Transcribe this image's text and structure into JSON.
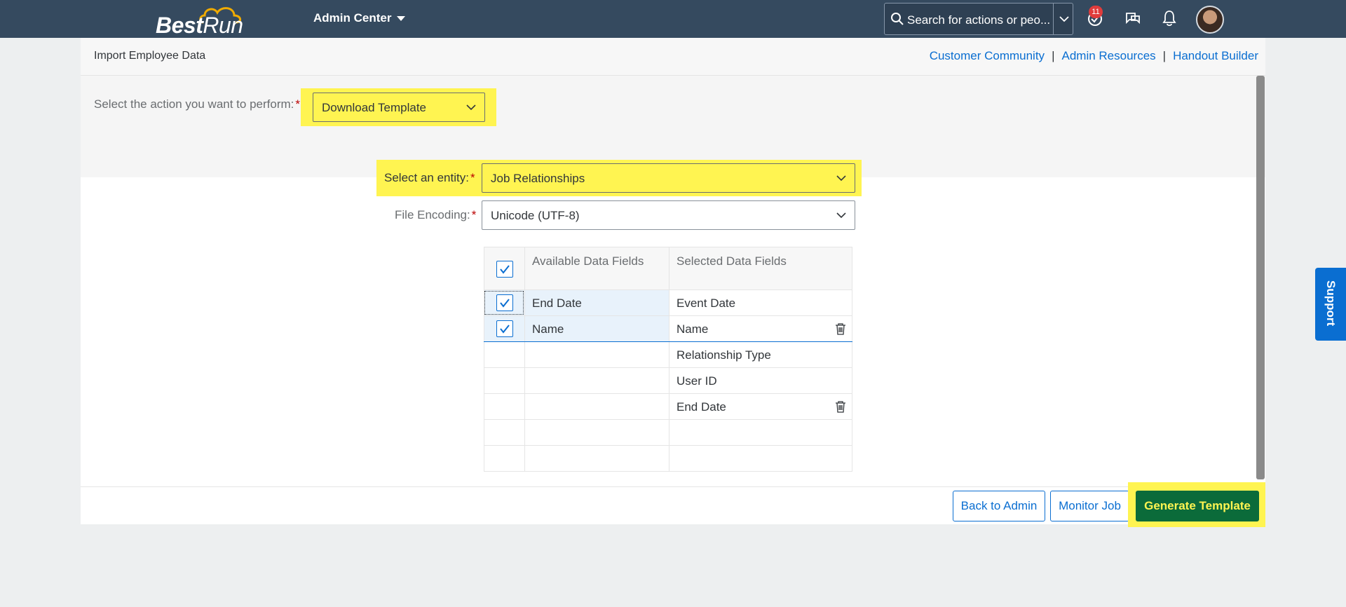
{
  "shell": {
    "logo_main": "Best",
    "logo_run": "Run",
    "menu_title": "Admin Center",
    "search_placeholder": "Search for actions or peo...",
    "notification_count": "11"
  },
  "header": {
    "title": "Import Employee Data",
    "links": [
      "Customer Community",
      "Admin Resources",
      "Handout Builder"
    ],
    "separator": "|"
  },
  "form": {
    "action_label": "Select the action you want to perform:",
    "action_value": "Download Template",
    "entity_label": "Select an entity:",
    "entity_value": "Job Relationships",
    "encoding_label": "File Encoding:",
    "encoding_value": "Unicode (UTF-8)",
    "required_mark": "*"
  },
  "table": {
    "header_available": "Available Data Fields",
    "header_selected": "Selected Data Fields",
    "rows": [
      {
        "available": "End Date",
        "selected": "Event Date"
      },
      {
        "available": "Name",
        "selected": "Name"
      },
      {
        "available": "",
        "selected": "Relationship Type"
      },
      {
        "available": "",
        "selected": "User ID"
      },
      {
        "available": "",
        "selected": "End Date"
      },
      {
        "available": "",
        "selected": ""
      },
      {
        "available": "",
        "selected": ""
      }
    ]
  },
  "buttons": {
    "back": "Back to Admin",
    "monitor": "Monitor Job",
    "generate": "Generate Template"
  },
  "support_tab": "Support",
  "colors": {
    "shell": "#354a5f",
    "highlight": "#fff451",
    "link": "#0a6ed1",
    "primary_button": "#0b6b3a"
  }
}
